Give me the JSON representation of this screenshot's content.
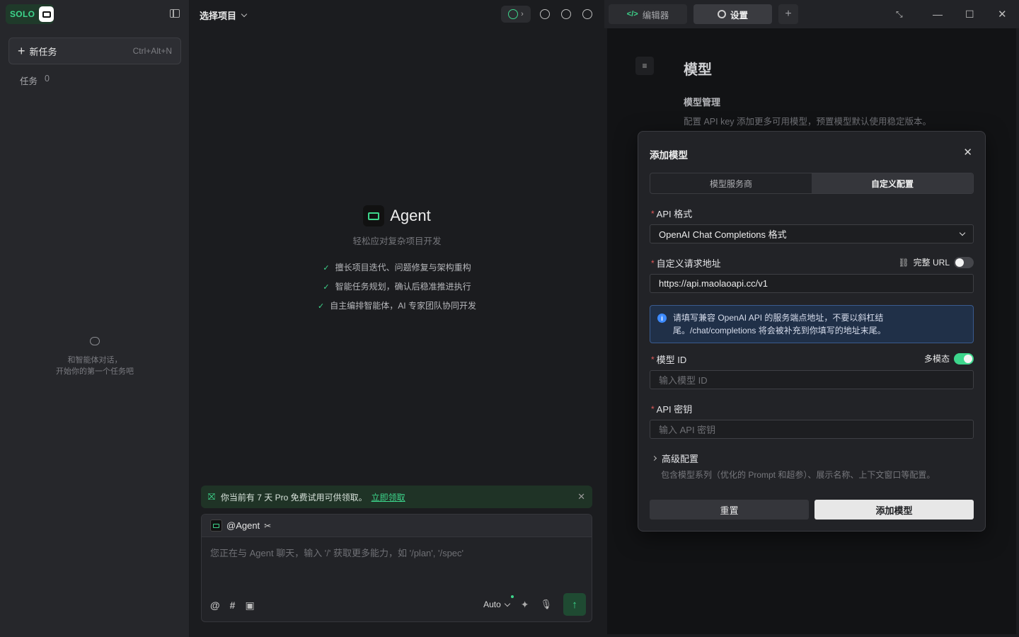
{
  "sidebar": {
    "logo_text": "SOLO",
    "new_task_label": "新任务",
    "new_task_shortcut": "Ctrl+Alt+N",
    "tasks_label": "任务",
    "tasks_count": "0",
    "empty_line1": "和智能体对话，",
    "empty_line2": "开始你的第一个任务吧"
  },
  "center": {
    "project_selector": "选择项目",
    "hero_title": "Agent",
    "hero_subtitle": "轻松应对复杂项目开发",
    "features": [
      "擅长项目迭代、问题修复与架构重构",
      "智能任务规划，确认后稳准推进执行",
      "自主编排智能体，AI 专家团队协同开发"
    ],
    "promo_text": "你当前有 7 天 Pro 免费试用可供领取。",
    "promo_link": "立即领取",
    "composer_agent": "@Agent",
    "composer_placeholder": "您正在与 Agent 聊天，输入 '/' 获取更多能力，如 '/plan', '/spec'",
    "composer_mode": "Auto"
  },
  "right_tabs": {
    "editor": "编辑器",
    "settings": "设置"
  },
  "settings": {
    "title": "模型",
    "section": "模型管理",
    "description": "配置 API key 添加更多可用模型，预置模型默认使用稳定版本。"
  },
  "modal": {
    "title": "添加模型",
    "tab_provider": "模型服务商",
    "tab_custom": "自定义配置",
    "api_format_label": "API 格式",
    "api_format_value": "OpenAI Chat Completions 格式",
    "url_label": "自定义请求地址",
    "full_url_label": "完整 URL",
    "url_value": "https://api.maolaoapi.cc/v1",
    "info_line1": "请填写兼容 OpenAI API 的服务端点地址，不要以斜杠结",
    "info_line2": "尾。/chat/completions 将会被补充到你填写的地址末尾。",
    "model_id_label": "模型 ID",
    "multimodal_label": "多模态",
    "model_id_placeholder": "输入模型 ID",
    "api_key_label": "API 密钥",
    "api_key_placeholder": "输入 API 密钥",
    "advanced_label": "高级配置",
    "advanced_desc": "包含模型系列（优化的 Prompt 和超参）、展示名称、上下文窗口等配置。",
    "reset_button": "重置",
    "add_button": "添加模型"
  },
  "colors": {
    "accent": "#3dd68c",
    "info": "#3d8bff"
  }
}
